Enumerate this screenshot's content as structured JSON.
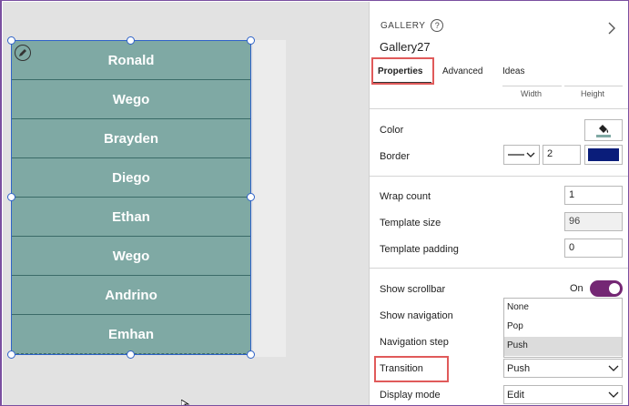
{
  "gallery": {
    "items": [
      "Ronald",
      "Wego",
      "Brayden",
      "Diego",
      "Ethan",
      "Wego",
      "Andrino",
      "Emhan"
    ]
  },
  "panel": {
    "control_type": "GALLERY",
    "control_name": "Gallery27",
    "tabs": [
      {
        "label": "Properties",
        "active": true
      },
      {
        "label": "Advanced",
        "active": false
      },
      {
        "label": "Ideas",
        "active": false
      }
    ],
    "columns": [
      "Width",
      "Height"
    ],
    "properties": {
      "color_label": "Color",
      "border_label": "Border",
      "border_width": "2",
      "border_color": "#0a1d7a",
      "wrap_count_label": "Wrap count",
      "wrap_count": "1",
      "template_size_label": "Template size",
      "template_size": "96",
      "template_padding_label": "Template padding",
      "template_padding": "0",
      "show_scrollbar_label": "Show scrollbar",
      "show_scrollbar_value": "On",
      "show_navigation_label": "Show navigation",
      "navigation_step_label": "Navigation step",
      "transition_label": "Transition",
      "transition_value": "Push",
      "transition_options": [
        "None",
        "Pop",
        "Push"
      ],
      "display_mode_label": "Display mode",
      "display_mode_value": "Edit"
    }
  },
  "colors": {
    "gallery_fill": "#7fa9a4",
    "selection": "#2f63c8",
    "toggle_on": "#742774",
    "highlight": "#e05a5a"
  }
}
